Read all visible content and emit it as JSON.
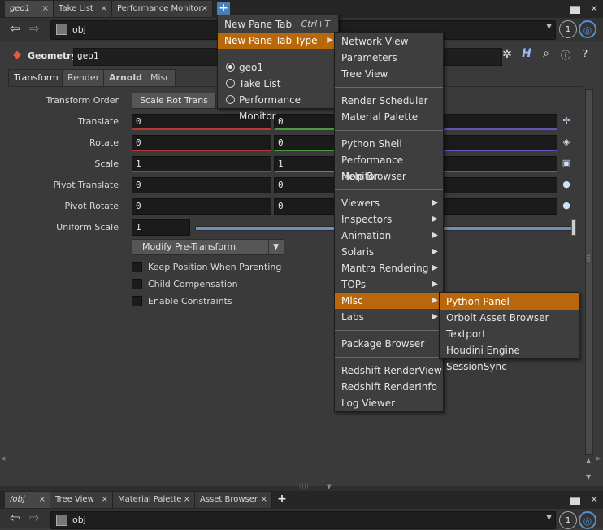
{
  "top_tabs": [
    {
      "label": "geo1",
      "close": "×"
    },
    {
      "label": "Take List",
      "close": "×"
    },
    {
      "label": "Performance Monitor",
      "close": "×"
    }
  ],
  "add_tab": "+",
  "path": {
    "label": "obj",
    "badge": "1"
  },
  "param_header": {
    "type": "Geometry",
    "name": "geo1"
  },
  "sub_tabs": [
    "Transform",
    "Render",
    "Arnold",
    "Misc"
  ],
  "params": {
    "transform_order_label": "Transform Order",
    "transform_order_value": "Scale Rot Trans",
    "translate": {
      "label": "Translate",
      "x": "0",
      "y": "0"
    },
    "rotate": {
      "label": "Rotate",
      "x": "0",
      "y": "0"
    },
    "scale": {
      "label": "Scale",
      "x": "1",
      "y": "1"
    },
    "pivot_translate": {
      "label": "Pivot Translate",
      "x": "0",
      "y": "0"
    },
    "pivot_rotate": {
      "label": "Pivot Rotate",
      "x": "0",
      "y": "0"
    },
    "uniform_scale": {
      "label": "Uniform Scale",
      "value": "1"
    },
    "modify_pre_transform": "Modify Pre-Transform",
    "checkboxes": [
      "Keep Position When Parenting",
      "Child Compensation",
      "Enable Constraints"
    ]
  },
  "menu1": {
    "new_pane_tab": "New Pane Tab",
    "new_pane_tab_shortcut": "Ctrl+T",
    "new_pane_tab_type": "New Pane Tab Type",
    "radios": [
      "geo1",
      "Take List",
      "Performance Monitor"
    ]
  },
  "menu2": {
    "group1": [
      "Network View",
      "Parameters",
      "Tree View"
    ],
    "group2": [
      "Render Scheduler",
      "Material Palette"
    ],
    "group3": [
      "Python Shell",
      "Performance Monitor",
      "Help Browser"
    ],
    "group4": [
      "Viewers",
      "Inspectors",
      "Animation",
      "Solaris",
      "Mantra Rendering",
      "TOPs",
      "Misc",
      "Labs"
    ],
    "group5": [
      "Package Browser"
    ],
    "group6": [
      "Redshift RenderView",
      "Redshift RenderInfo",
      "Log Viewer"
    ]
  },
  "menu3": [
    "Python Panel",
    "Orbolt Asset Browser",
    "Textport",
    "Houdini Engine SessionSync"
  ],
  "bottom_tabs": [
    {
      "label": "/obj",
      "close": "×"
    },
    {
      "label": "Tree View",
      "close": "×"
    },
    {
      "label": "Material Palette",
      "close": "×"
    },
    {
      "label": "Asset Browser",
      "close": "×"
    }
  ],
  "bottom_path": {
    "label": "obj",
    "badge": "1"
  },
  "colors": {
    "accent_menu": "#b8680a",
    "accent_blue": "#5b8fd1"
  }
}
